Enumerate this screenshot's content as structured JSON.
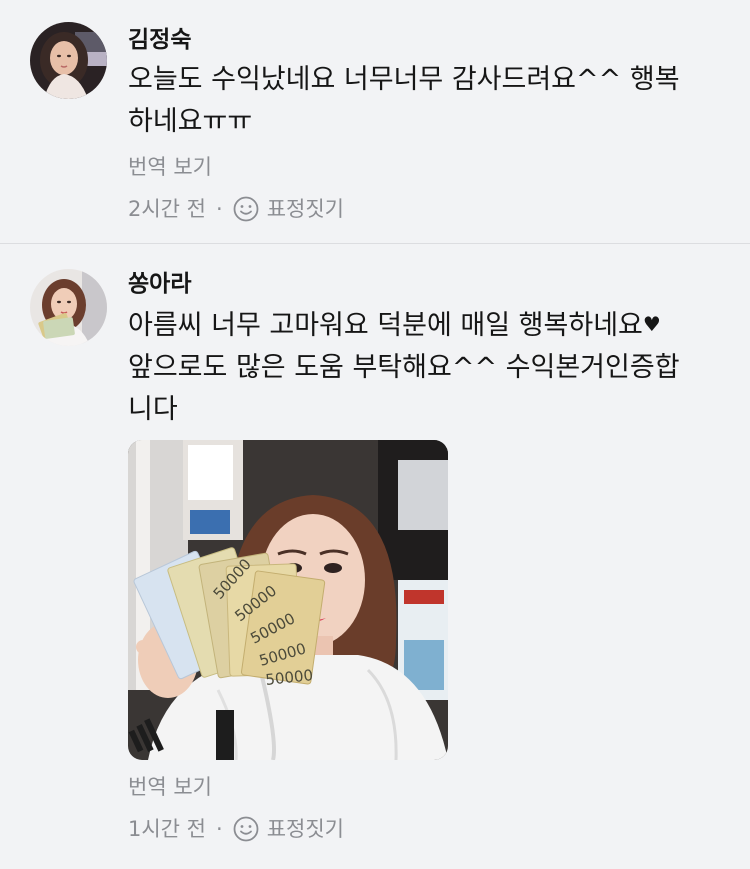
{
  "comments": [
    {
      "author": "김정숙",
      "text": "오늘도 수익났네요 너무너무 감사드려요^^ 행복\n하네요ㅠㅠ",
      "translate_label": "번역 보기",
      "time": "2시간 전",
      "dot": "·",
      "react_label": "표정짓기"
    },
    {
      "author": "쏭아라",
      "text": "아름씨 너무 고마워요 덕분에 매일 행복하네요",
      "text_heart": "♥",
      "text_rest": "앞으로도 많은 도움 부탁해요^^ 수익본거인증합\n니다",
      "translate_label": "번역 보기",
      "time": "1시간 전",
      "dot": "·",
      "react_label": "표정짓기"
    }
  ],
  "photo_text": {
    "banknote": "50000"
  },
  "colors": {
    "background": "#f2f3f5",
    "secondary_text": "#8b8d92",
    "primary_text": "#161616"
  },
  "icons": [
    "smiley-icon"
  ]
}
